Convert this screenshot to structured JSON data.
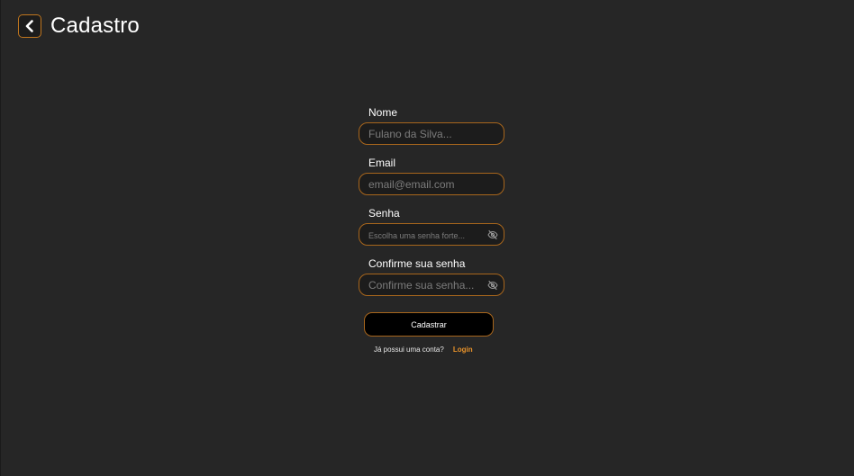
{
  "header": {
    "title": "Cadastro",
    "back_icon": "chevron-left-icon"
  },
  "form": {
    "name": {
      "label": "Nome",
      "placeholder": "Fulano da Silva...",
      "value": ""
    },
    "email": {
      "label": "Email",
      "placeholder": "email@email.com",
      "value": ""
    },
    "password": {
      "label": "Senha",
      "placeholder": "Escolha uma senha forte...",
      "value": "",
      "toggle_icon": "eye-off-icon"
    },
    "confirm_password": {
      "label": "Confirme sua senha",
      "placeholder": "Confirme sua senha...",
      "value": "",
      "toggle_icon": "eye-off-icon"
    },
    "submit_label": "Cadastrar"
  },
  "login_prompt": {
    "question": "Já possui uma conta?",
    "link_label": "Login"
  },
  "colors": {
    "background": "#262626",
    "accent": "#a8661c",
    "link": "#e8922a",
    "input_background": "#1c1c1c",
    "button_background": "#000000"
  }
}
